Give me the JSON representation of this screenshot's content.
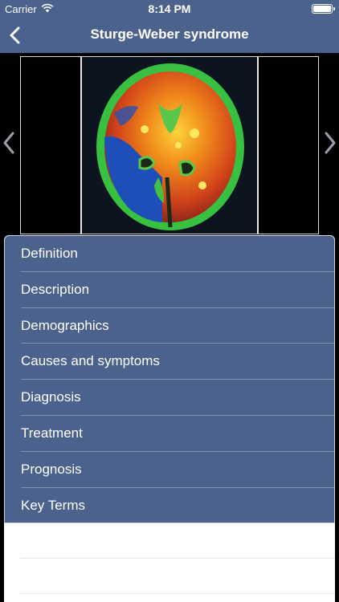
{
  "status_bar": {
    "carrier": "Carrier",
    "time": "8:14 PM"
  },
  "nav": {
    "title": "Sturge-Weber syndrome",
    "back_icon": "chevron-left-icon"
  },
  "image": {
    "alt": "brain scan image"
  },
  "menu": {
    "items": [
      {
        "label": "Definition"
      },
      {
        "label": "Description"
      },
      {
        "label": "Demographics"
      },
      {
        "label": "Causes and symptoms"
      },
      {
        "label": "Diagnosis"
      },
      {
        "label": "Treatment"
      },
      {
        "label": "Prognosis"
      },
      {
        "label": "Key Terms"
      }
    ]
  },
  "colors": {
    "bar_blue": "#4b628d",
    "menu_blue": "#4b628d",
    "background": "#000000"
  }
}
